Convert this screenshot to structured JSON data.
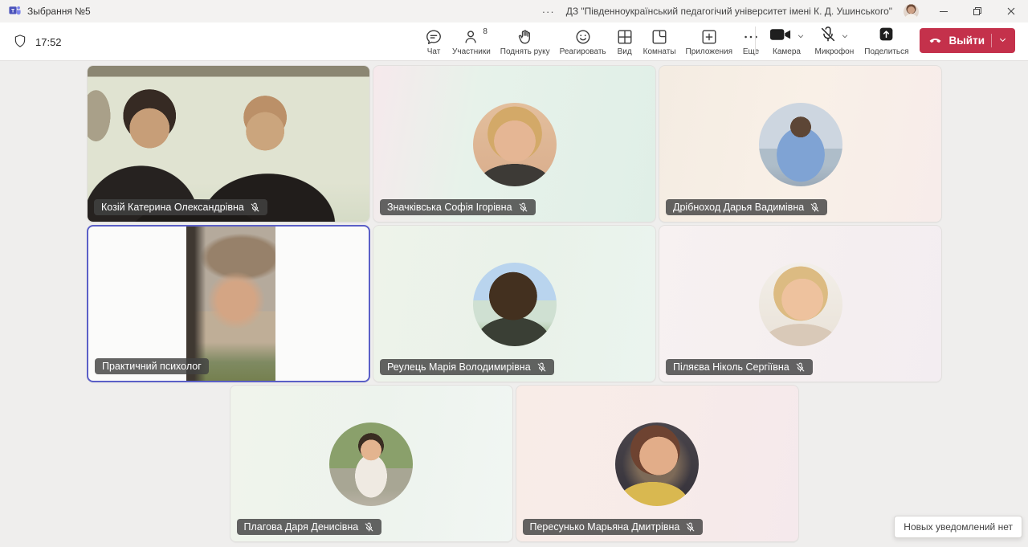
{
  "window": {
    "app_title": "Зыбрання №5",
    "more_options": "···",
    "meeting_org_title": "ДЗ \"Південноукраїнський педагогічий університет імені К. Д. Ушинського\""
  },
  "toolbar": {
    "time": "17:52",
    "center_items": [
      {
        "id": "chat",
        "label": "Чат",
        "icon": "chat-icon"
      },
      {
        "id": "participants",
        "label": "Участники",
        "icon": "participants-icon",
        "badge": "8"
      },
      {
        "id": "raise-hand",
        "label": "Поднять руку",
        "icon": "raise-hand-icon"
      },
      {
        "id": "react",
        "label": "Реагировать",
        "icon": "react-smiley-icon"
      },
      {
        "id": "view",
        "label": "Вид",
        "icon": "view-grid-icon"
      },
      {
        "id": "rooms",
        "label": "Комнаты",
        "icon": "breakout-rooms-icon"
      },
      {
        "id": "apps",
        "label": "Приложения",
        "icon": "apps-plus-icon"
      },
      {
        "id": "more",
        "label": "Еще",
        "icon": "more-dots-icon"
      }
    ],
    "camera": {
      "label": "Камера",
      "state": "on"
    },
    "microphone": {
      "label": "Микрофон",
      "state": "muted"
    },
    "share": {
      "label": "Поделиться"
    },
    "leave": {
      "label": "Выйти"
    }
  },
  "participants_grid": [
    {
      "name": "Козій Катерина Олександрівна",
      "muted": true,
      "type": "video-duo",
      "active": false
    },
    {
      "name": "Значківська Софія Ігорівна",
      "muted": true,
      "type": "avatar",
      "active": false
    },
    {
      "name": "Дрібноход Дарья Вадимівна",
      "muted": true,
      "type": "avatar",
      "active": false
    },
    {
      "name": "Практичний психолог",
      "muted": false,
      "type": "video-portrait",
      "active": true
    },
    {
      "name": "Реулець Марія Володимирівна",
      "muted": true,
      "type": "avatar",
      "active": false
    },
    {
      "name": "Піляєва Ніколь Сергіївна",
      "muted": true,
      "type": "avatar",
      "active": false
    },
    {
      "name": "Плагова Даря Денисівна",
      "muted": true,
      "type": "avatar",
      "active": false
    },
    {
      "name": "Пересунько Марьяна Дмитрівна",
      "muted": true,
      "type": "avatar",
      "active": false
    }
  ],
  "notification": {
    "text": "Новых уведомлений нет"
  },
  "colors": {
    "leave_button": "#c4314b",
    "active_speaker_border": "#5b5fc7",
    "teams_brand": "#4b53bc"
  }
}
